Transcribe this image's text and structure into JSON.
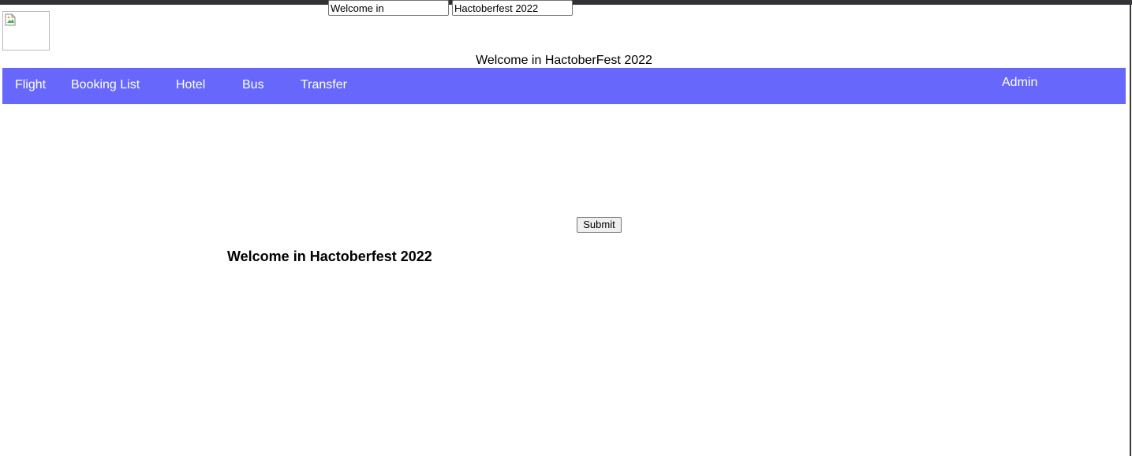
{
  "colors": {
    "top_strip": "#323236",
    "navbar_bg": "#6767fc",
    "navbar_text": "#ffffff",
    "right_edge": "#3a3a3a"
  },
  "logo": {
    "icon": "broken-image-icon"
  },
  "header": {
    "welcome_text": "Welcome in HactoberFest 2022"
  },
  "nav": {
    "items": [
      {
        "label": "Flight"
      },
      {
        "label": "Booking List"
      },
      {
        "label": "Hotel"
      },
      {
        "label": "Bus"
      },
      {
        "label": "Transfer"
      }
    ],
    "admin_label": "Admin"
  },
  "form": {
    "first_value": "Welcome in",
    "second_value": "Hactoberfest 2022",
    "submit_label": "Submit"
  },
  "main": {
    "heading": "Welcome in Hactoberfest 2022"
  }
}
